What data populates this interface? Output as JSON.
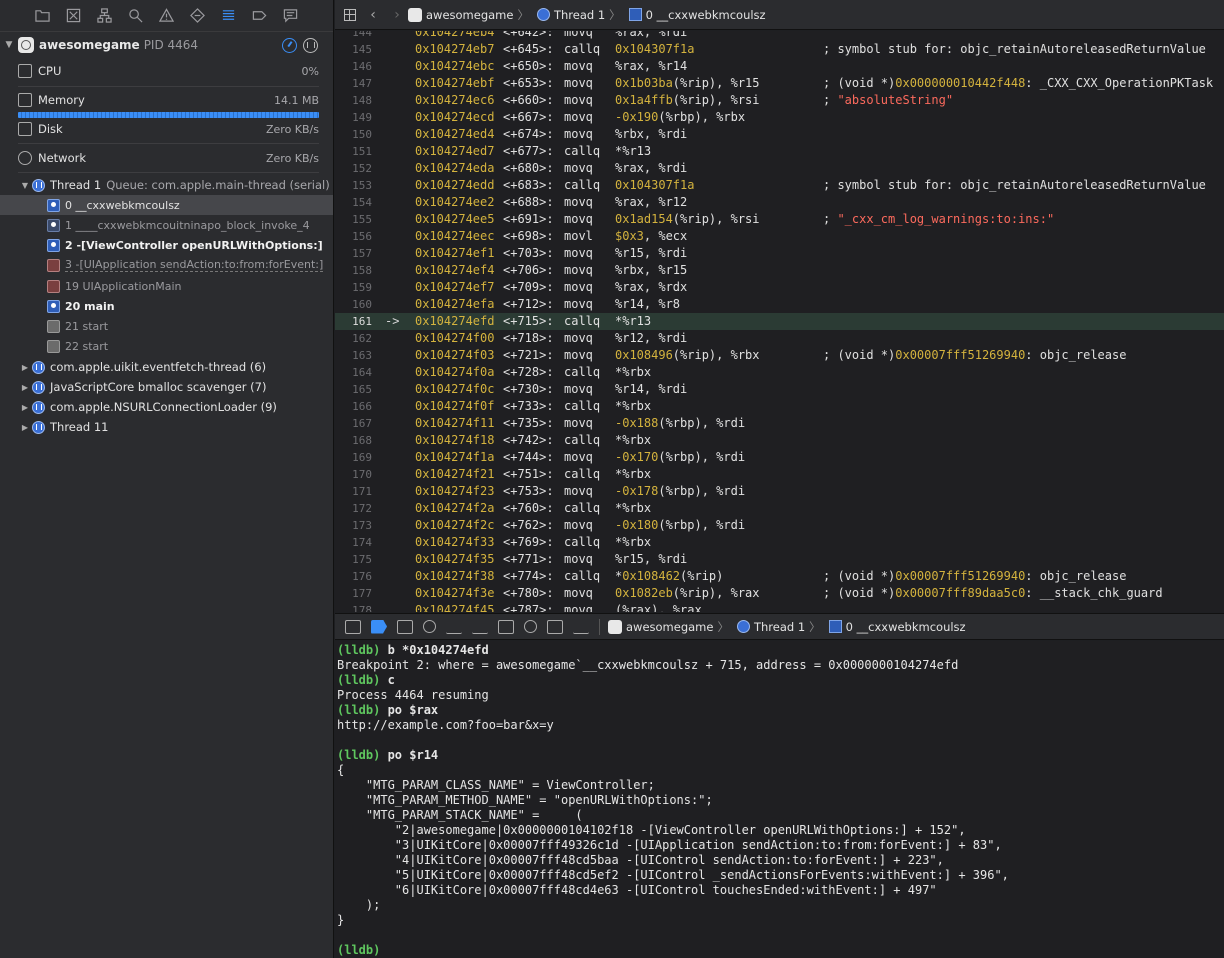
{
  "navigator": {
    "toolbar_icons": [
      "folder-icon",
      "source-control-icon",
      "hierarchy-icon",
      "search-icon",
      "warning-icon",
      "test-icon",
      "debug-icon",
      "breakpoint-icon",
      "report-icon"
    ],
    "process": {
      "name": "awesomegame",
      "pid": "PID 4464"
    },
    "resources": [
      {
        "label": "CPU",
        "value": "0%"
      },
      {
        "label": "Memory",
        "value": "14.1 MB"
      },
      {
        "label": "Disk",
        "value": "Zero KB/s"
      },
      {
        "label": "Network",
        "value": "Zero KB/s"
      }
    ],
    "thread1": {
      "name": "Thread 1",
      "queue": "Queue: com.apple.main-thread (serial)"
    },
    "frames": [
      "0 __cxxwebkmcoulsz",
      "1 ____cxxwebkmcouitninapo_block_invoke_4",
      "2 -[ViewController openURLWithOptions:]",
      "3 -[UIApplication sendAction:to:from:forEvent:]",
      "19 UIApplicationMain",
      "20 main",
      "21 start",
      "22 start"
    ],
    "other_threads": [
      "com.apple.uikit.eventfetch-thread (6)",
      "JavaScriptCore bmalloc scavenger (7)",
      "com.apple.NSURLConnectionLoader (9)",
      "Thread 11"
    ]
  },
  "jumpbar": {
    "app": "awesomegame",
    "thread": "Thread 1",
    "frame": "0 __cxxwebkmcoulsz"
  },
  "disassembly": [
    {
      "ln": "144",
      "addr": "0x104274eb4",
      "off": "<+642>:",
      "mn": "movq",
      "ops": "%rax, %rdi",
      "cm": ""
    },
    {
      "ln": "145",
      "addr": "0x104274eb7",
      "off": "<+645>:",
      "mn": "callq",
      "ops": "0x104307f1a",
      "cm": "; symbol stub for: objc_retainAutoreleasedReturnValue"
    },
    {
      "ln": "146",
      "addr": "0x104274ebc",
      "off": "<+650>:",
      "mn": "movq",
      "ops": "%rax, %r14",
      "cm": ""
    },
    {
      "ln": "147",
      "addr": "0x104274ebf",
      "off": "<+653>:",
      "mn": "movq",
      "ops": "0x1b03ba(%rip), %r15",
      "cm": "; (void *)0x000000010442f448: _CXX_CXX_OperationPKTask"
    },
    {
      "ln": "148",
      "addr": "0x104274ec6",
      "off": "<+660>:",
      "mn": "movq",
      "ops": "0x1a4ffb(%rip), %rsi",
      "cm": "; \"absoluteString\""
    },
    {
      "ln": "149",
      "addr": "0x104274ecd",
      "off": "<+667>:",
      "mn": "movq",
      "ops": "-0x190(%rbp), %rbx",
      "cm": ""
    },
    {
      "ln": "150",
      "addr": "0x104274ed4",
      "off": "<+674>:",
      "mn": "movq",
      "ops": "%rbx, %rdi",
      "cm": ""
    },
    {
      "ln": "151",
      "addr": "0x104274ed7",
      "off": "<+677>:",
      "mn": "callq",
      "ops": "*%r13",
      "cm": ""
    },
    {
      "ln": "152",
      "addr": "0x104274eda",
      "off": "<+680>:",
      "mn": "movq",
      "ops": "%rax, %rdi",
      "cm": ""
    },
    {
      "ln": "153",
      "addr": "0x104274edd",
      "off": "<+683>:",
      "mn": "callq",
      "ops": "0x104307f1a",
      "cm": "; symbol stub for: objc_retainAutoreleasedReturnValue"
    },
    {
      "ln": "154",
      "addr": "0x104274ee2",
      "off": "<+688>:",
      "mn": "movq",
      "ops": "%rax, %r12",
      "cm": ""
    },
    {
      "ln": "155",
      "addr": "0x104274ee5",
      "off": "<+691>:",
      "mn": "movq",
      "ops": "0x1ad154(%rip), %rsi",
      "cm": "; \"_cxx_cm_log_warnings:to:ins:\""
    },
    {
      "ln": "156",
      "addr": "0x104274eec",
      "off": "<+698>:",
      "mn": "movl",
      "ops": "$0x3, %ecx",
      "cm": ""
    },
    {
      "ln": "157",
      "addr": "0x104274ef1",
      "off": "<+703>:",
      "mn": "movq",
      "ops": "%r15, %rdi",
      "cm": ""
    },
    {
      "ln": "158",
      "addr": "0x104274ef4",
      "off": "<+706>:",
      "mn": "movq",
      "ops": "%rbx, %r15",
      "cm": ""
    },
    {
      "ln": "159",
      "addr": "0x104274ef7",
      "off": "<+709>:",
      "mn": "movq",
      "ops": "%rax, %rdx",
      "cm": ""
    },
    {
      "ln": "160",
      "addr": "0x104274efa",
      "off": "<+712>:",
      "mn": "movq",
      "ops": "%r14, %r8",
      "cm": ""
    },
    {
      "ln": "161",
      "arrow": "->",
      "addr": "0x104274efd",
      "off": "<+715>:",
      "mn": "callq",
      "ops": "*%r13",
      "cm": "",
      "current": true
    },
    {
      "ln": "162",
      "addr": "0x104274f00",
      "off": "<+718>:",
      "mn": "movq",
      "ops": "%r12, %rdi",
      "cm": ""
    },
    {
      "ln": "163",
      "addr": "0x104274f03",
      "off": "<+721>:",
      "mn": "movq",
      "ops": "0x108496(%rip), %rbx",
      "cm": "; (void *)0x00007fff51269940: objc_release"
    },
    {
      "ln": "164",
      "addr": "0x104274f0a",
      "off": "<+728>:",
      "mn": "callq",
      "ops": "*%rbx",
      "cm": ""
    },
    {
      "ln": "165",
      "addr": "0x104274f0c",
      "off": "<+730>:",
      "mn": "movq",
      "ops": "%r14, %rdi",
      "cm": ""
    },
    {
      "ln": "166",
      "addr": "0x104274f0f",
      "off": "<+733>:",
      "mn": "callq",
      "ops": "*%rbx",
      "cm": ""
    },
    {
      "ln": "167",
      "addr": "0x104274f11",
      "off": "<+735>:",
      "mn": "movq",
      "ops": "-0x188(%rbp), %rdi",
      "cm": ""
    },
    {
      "ln": "168",
      "addr": "0x104274f18",
      "off": "<+742>:",
      "mn": "callq",
      "ops": "*%rbx",
      "cm": ""
    },
    {
      "ln": "169",
      "addr": "0x104274f1a",
      "off": "<+744>:",
      "mn": "movq",
      "ops": "-0x170(%rbp), %rdi",
      "cm": ""
    },
    {
      "ln": "170",
      "addr": "0x104274f21",
      "off": "<+751>:",
      "mn": "callq",
      "ops": "*%rbx",
      "cm": ""
    },
    {
      "ln": "171",
      "addr": "0x104274f23",
      "off": "<+753>:",
      "mn": "movq",
      "ops": "-0x178(%rbp), %rdi",
      "cm": ""
    },
    {
      "ln": "172",
      "addr": "0x104274f2a",
      "off": "<+760>:",
      "mn": "callq",
      "ops": "*%rbx",
      "cm": ""
    },
    {
      "ln": "173",
      "addr": "0x104274f2c",
      "off": "<+762>:",
      "mn": "movq",
      "ops": "-0x180(%rbp), %rdi",
      "cm": ""
    },
    {
      "ln": "174",
      "addr": "0x104274f33",
      "off": "<+769>:",
      "mn": "callq",
      "ops": "*%rbx",
      "cm": ""
    },
    {
      "ln": "175",
      "addr": "0x104274f35",
      "off": "<+771>:",
      "mn": "movq",
      "ops": "%r15, %rdi",
      "cm": ""
    },
    {
      "ln": "176",
      "addr": "0x104274f38",
      "off": "<+774>:",
      "mn": "callq",
      "ops": "*0x108462(%rip)",
      "cm": "; (void *)0x00007fff51269940: objc_release"
    },
    {
      "ln": "177",
      "addr": "0x104274f3e",
      "off": "<+780>:",
      "mn": "movq",
      "ops": "0x1082eb(%rip), %rax",
      "cm": "; (void *)0x00007fff89daa5c0: __stack_chk_guard"
    },
    {
      "ln": "178",
      "addr": "0x104274f45",
      "off": "<+787>:",
      "mn": "movq",
      "ops": "(%rax), %rax",
      "cm": ""
    }
  ],
  "debugbar": {
    "app": "awesomegame",
    "thread": "Thread 1",
    "frame": "0 __cxxwebkmcoulsz"
  },
  "console": [
    {
      "prompt": "(lldb)",
      "text": " b *0x104274efd"
    },
    {
      "text": "Breakpoint 2: where = awesomegame`__cxxwebkmcoulsz + 715, address = 0x0000000104274efd"
    },
    {
      "prompt": "(lldb)",
      "text": " c"
    },
    {
      "text": "Process 4464 resuming"
    },
    {
      "prompt": "(lldb)",
      "text": " po $rax"
    },
    {
      "text": "http://example.com?foo=bar&x=y"
    },
    {
      "text": ""
    },
    {
      "prompt": "(lldb)",
      "text": " po $r14"
    },
    {
      "text": "{"
    },
    {
      "text": "    \"MTG_PARAM_CLASS_NAME\" = ViewController;"
    },
    {
      "text": "    \"MTG_PARAM_METHOD_NAME\" = \"openURLWithOptions:\";"
    },
    {
      "text": "    \"MTG_PARAM_STACK_NAME\" =     ("
    },
    {
      "text": "        \"2|awesomegame|0x0000000104102f18 -[ViewController openURLWithOptions:] + 152\","
    },
    {
      "text": "        \"3|UIKitCore|0x00007fff49326c1d -[UIApplication sendAction:to:from:forEvent:] + 83\","
    },
    {
      "text": "        \"4|UIKitCore|0x00007fff48cd5baa -[UIControl sendAction:to:forEvent:] + 223\","
    },
    {
      "text": "        \"5|UIKitCore|0x00007fff48cd5ef2 -[UIControl _sendActionsForEvents:withEvent:] + 396\","
    },
    {
      "text": "        \"6|UIKitCore|0x00007fff48cd4e63 -[UIControl touchesEnded:withEvent:] + 497\""
    },
    {
      "text": "    );"
    },
    {
      "text": "}"
    },
    {
      "text": ""
    },
    {
      "prompt": "(lldb)",
      "text": ""
    }
  ]
}
